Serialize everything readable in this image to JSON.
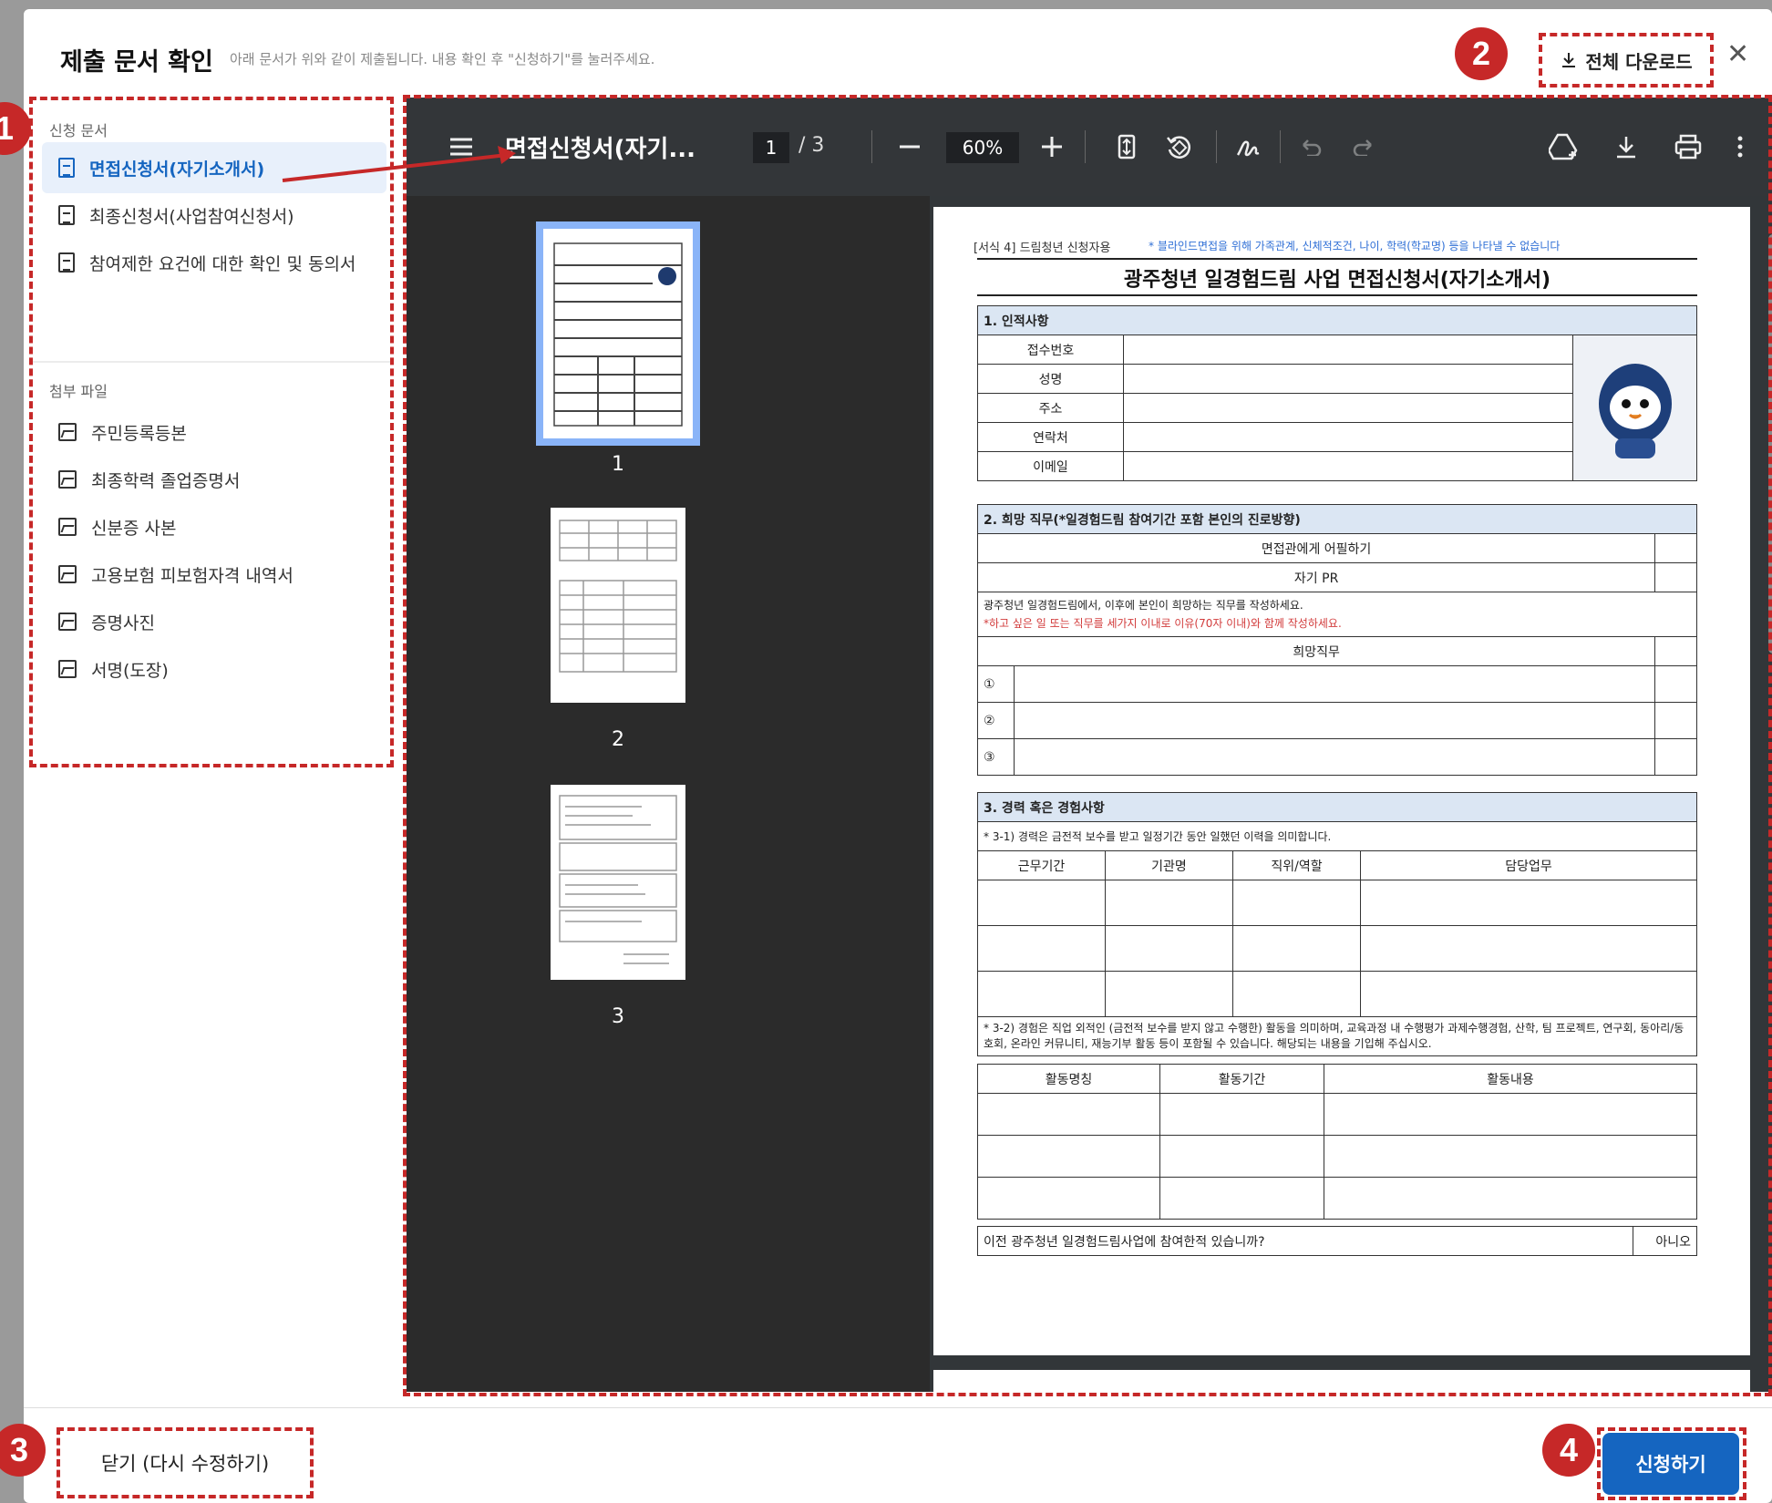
{
  "modal": {
    "title": "제출 문서 확인",
    "description": "아래 문서가 위와 같이 제출됩니다. 내용 확인 후 \"신청하기\"를 눌러주세요.",
    "download_all_label": "전체 다운로드",
    "close_glyph": "✕"
  },
  "markers": [
    "1",
    "2",
    "3",
    "4"
  ],
  "sidebar": {
    "section_docs": "신청 문서",
    "docs": [
      {
        "label": "면접신청서(자기소개서)",
        "active": true
      },
      {
        "label": "최종신청서(사업참여신청서)",
        "active": false
      },
      {
        "label": "참여제한 요건에 대한 확인 및 동의서",
        "active": false
      }
    ],
    "section_files": "첨부 파일",
    "files": [
      {
        "label": "주민등록등본"
      },
      {
        "label": "최종학력 졸업증명서"
      },
      {
        "label": "신분증 사본"
      },
      {
        "label": "고용보험 피보험자격 내역서"
      },
      {
        "label": "증명사진"
      },
      {
        "label": "서명(도장)"
      }
    ]
  },
  "viewer": {
    "menu_icon": "menu-icon",
    "doc_title": "면접신청서(자기...",
    "page_current": "1",
    "page_total": "/ 3",
    "zoom": "60%",
    "thumbnails": [
      "1",
      "2",
      "3"
    ]
  },
  "form": {
    "note_left": "[서식 4] 드림청년 신청자용",
    "note_right": "* 블라인드면접을 위해 가족관계, 신체적조건, 나이, 학력(학교명) 등을 나타낼 수 없습니다",
    "title": "광주청년 일경험드림 사업 면접신청서(자기소개서)",
    "sec1": "1. 인적사항",
    "sec1_rows": [
      "접수번호",
      "성명",
      "주소",
      "연락처",
      "이메일"
    ],
    "sec2": "2. 희망 직무(*일경험드림 참여기간 포함 본인의 진로방향)",
    "appeal": "면접관에게 어필하기",
    "self_pr": "자기 PR",
    "guide1": "광주청년 일경험드림에서, 이후에 본인이 희망하는 직무를 작성하세요.",
    "guide2": "*하고 싶은 일 또는 직무를 세가지 이내로 이유(70자 이내)와 함께 작성하세요.",
    "wish_job": "희망직무",
    "wish_nums": [
      "①",
      "②",
      "③"
    ],
    "sec3": "3. 경력 혹은 경험사항",
    "career_note": "* 3-1) 경력은 금전적 보수를 받고 일정기간 동안 일했던 이력을 의미합니다.",
    "career_headers": [
      "근무기간",
      "기관명",
      "직위/역할",
      "담당업무"
    ],
    "exp_note": "* 3-2) 경험은 직업 외적인 (금전적 보수를 받지 않고 수행한) 활동을 의미하며, 교육과정 내 수행평가 과제수행경험, 산학, 팀 프로젝트, 연구회, 동아리/동호회, 온라인 커뮤니티, 재능기부 활동 등이 포함될 수 있습니다. 해당되는 내용을 기입해 주십시오.",
    "exp_headers": [
      "활동명칭",
      "활동기간",
      "활동내용"
    ],
    "prev_question": "이전 광주청년 일경험드림사업에 참여한적 있습니까?",
    "prev_answer": "아니오"
  },
  "footer": {
    "close_label": "닫기 (다시 수정하기)",
    "submit_label": "신청하기"
  },
  "colors": {
    "accent": "#1565c0",
    "marker": "#c62828",
    "viewer_bg": "#323639"
  }
}
